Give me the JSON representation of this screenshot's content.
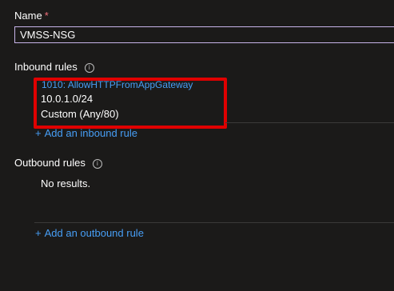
{
  "name_field": {
    "label": "Name",
    "required_marker": "*",
    "value": "VMSS-NSG"
  },
  "inbound": {
    "title": "Inbound rules",
    "info_icon": "i",
    "rule": {
      "name": "1010: AllowHTTPFromAppGateway",
      "source": "10.0.1.0/24",
      "service": "Custom (Any/80)"
    },
    "add_label": "Add an inbound rule"
  },
  "outbound": {
    "title": "Outbound rules",
    "info_icon": "i",
    "empty_text": "No results.",
    "add_label": "Add an outbound rule"
  },
  "colors": {
    "background": "#1b1a19",
    "link": "#479ef5",
    "highlight": "#e00000",
    "input_border": "#c7b4e9"
  }
}
